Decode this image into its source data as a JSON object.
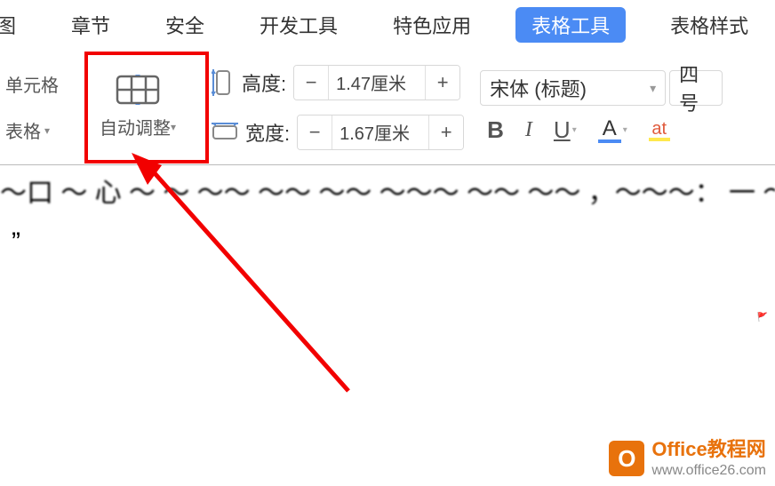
{
  "tabs": {
    "view": "图",
    "chapter": "章节",
    "security": "安全",
    "developer": "开发工具",
    "special": "特色应用",
    "table_tools": "表格工具",
    "table_style": "表格样式"
  },
  "ribbon": {
    "cell_label": "单元格",
    "table_label": "表格",
    "auto_adjust": "自动调整",
    "height_label": "高度:",
    "width_label": "宽度:",
    "height_value": "1.47厘米",
    "width_value": "1.67厘米",
    "minus": "−",
    "plus": "+"
  },
  "font": {
    "name": "宋体 (标题)",
    "size": "四号",
    "bold": "B",
    "italic": "I",
    "underline": "U",
    "color_a": "A",
    "highlight": "at"
  },
  "doc": {
    "line1": "〜口 〜 心 〜 〜 〜〜 〜〜 〜〜 〜〜〜 〜〜 〜〜 ，〜〜〜：    一 〜",
    "quote": "”"
  },
  "watermark": {
    "title": "Office教程网",
    "url": "www.office26.com",
    "icon": "O"
  }
}
